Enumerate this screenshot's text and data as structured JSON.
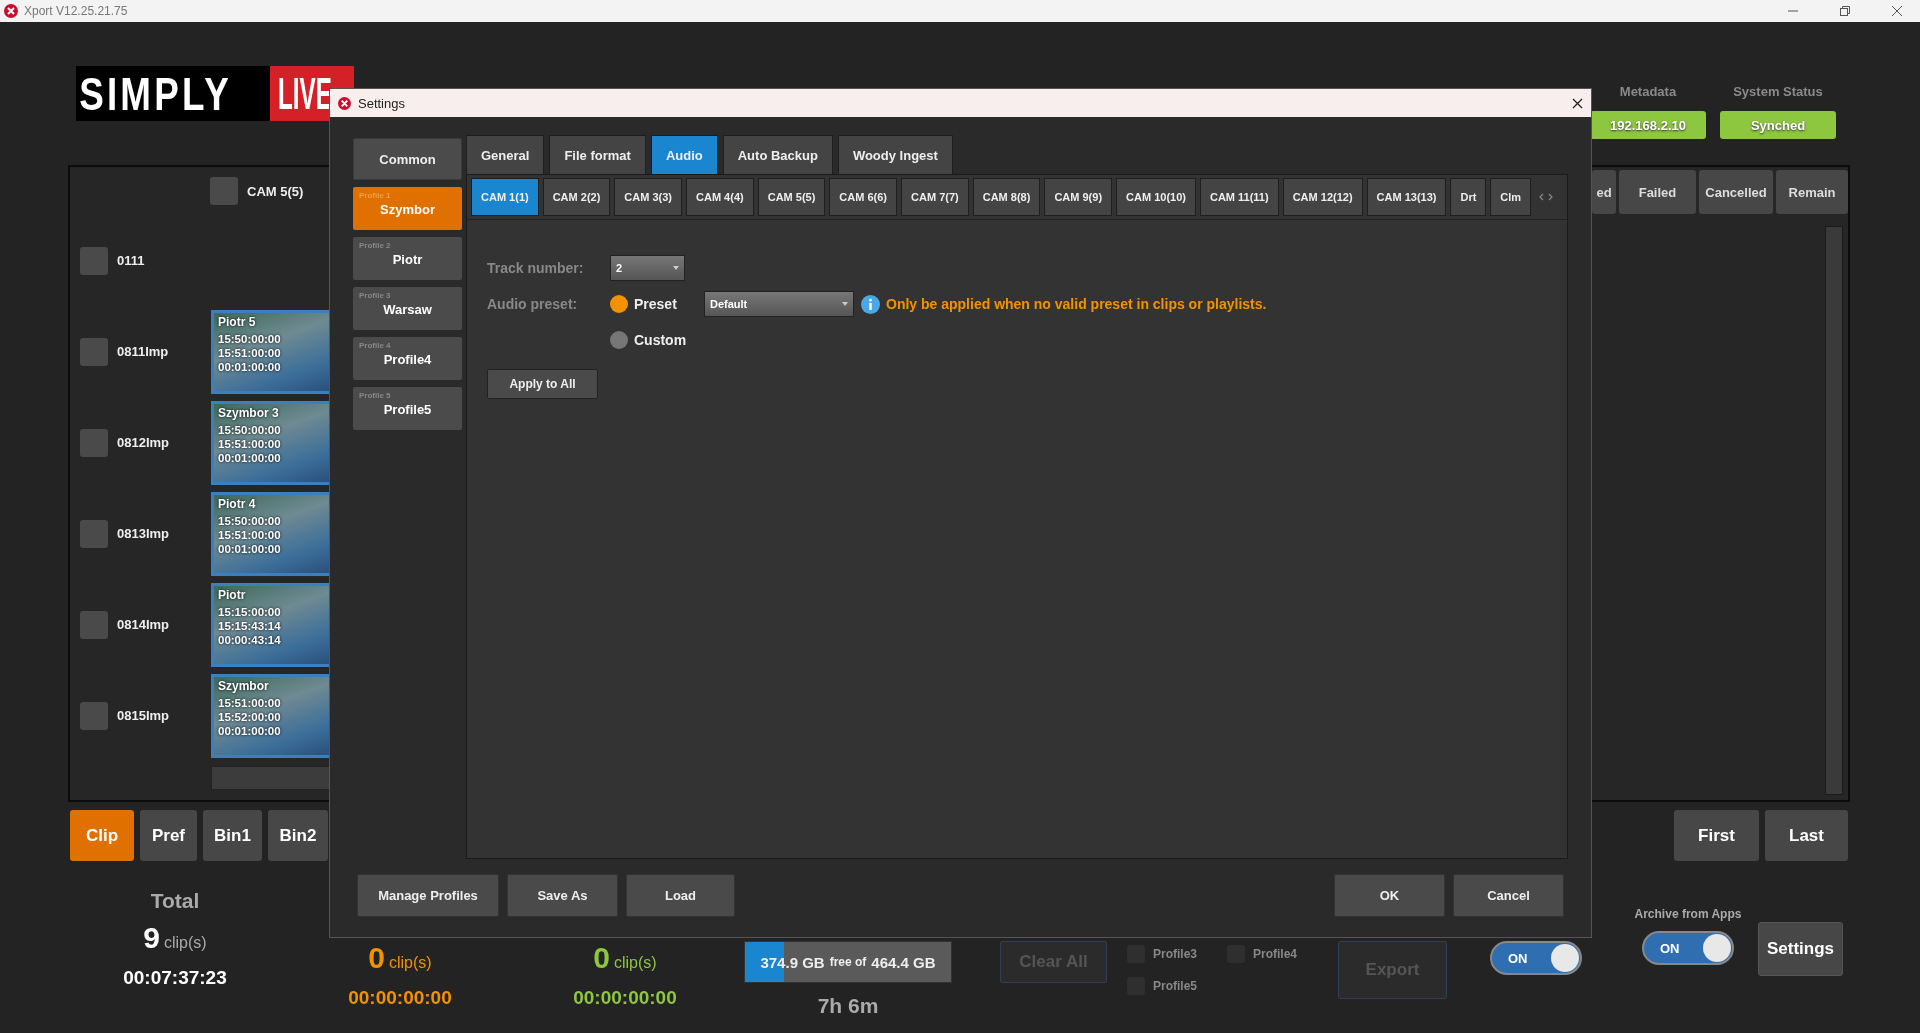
{
  "app": {
    "title": "Xport V12.25.21.75"
  },
  "logo": {
    "part_1": "SIMPLY",
    "part_2": "LIVE"
  },
  "header": {
    "metadata": {
      "label": "Metadata",
      "value": "192.168.2.10"
    },
    "system_status": {
      "label": "System Status",
      "value": "Synched"
    }
  },
  "clip_list": {
    "header": {
      "label": "CAM 5(5)",
      "checked": false
    },
    "rows": [
      {
        "label": "0111",
        "checked": false
      },
      {
        "label": "0811Imp",
        "checked": false,
        "thumbnail": {
          "title": "Piotr 5",
          "lines": [
            "15:50:00:00",
            "15:51:00:00",
            "00:01:00:00"
          ]
        }
      },
      {
        "label": "0812Imp",
        "checked": false,
        "thumbnail": {
          "title": "Szymbor 3",
          "lines": [
            "15:50:00:00",
            "15:51:00:00",
            "00:01:00:00"
          ]
        }
      },
      {
        "label": "0813Imp",
        "checked": false,
        "thumbnail": {
          "title": "Piotr 4",
          "lines": [
            "15:50:00:00",
            "15:51:00:00",
            "00:01:00:00"
          ]
        }
      },
      {
        "label": "0814Imp",
        "checked": false,
        "thumbnail": {
          "title": "Piotr",
          "lines": [
            "15:15:00:00",
            "15:15:43:14",
            "00:00:43:14"
          ]
        }
      },
      {
        "label": "0815Imp",
        "checked": false,
        "thumbnail": {
          "title": "Szymbor",
          "lines": [
            "15:51:00:00",
            "15:52:00:00",
            "00:01:00:00"
          ]
        }
      }
    ]
  },
  "status_columns": [
    "ed",
    "Failed",
    "Cancelled",
    "Remain"
  ],
  "bottom_tabs": [
    {
      "label": "Clip",
      "selected": true
    },
    {
      "label": "Pref",
      "selected": false
    },
    {
      "label": "Bin1",
      "selected": false
    },
    {
      "label": "Bin2",
      "selected": false
    }
  ],
  "nav_buttons": [
    "First",
    "Last"
  ],
  "stats": [
    {
      "label": "Total",
      "count": "9",
      "unit": "clip(s)",
      "duration": "00:07:37:23",
      "color": "#ffffff"
    },
    {
      "count": "0",
      "unit": "clip(s)",
      "duration": "00:00:00:00",
      "color": "#f39200"
    },
    {
      "count": "0",
      "unit": "clip(s)",
      "duration": "00:00:00:00",
      "color": "#8dc63f"
    }
  ],
  "storage": {
    "free": "374.9 GB",
    "free_of": "free of",
    "total": "464.4 GB",
    "level": 0.19,
    "remaining": "7h 6m"
  },
  "clear_all": {
    "label": "Clear All",
    "disabled": true
  },
  "profile_checks": [
    {
      "label": "Profile3",
      "checked": false
    },
    {
      "label": "Profile4",
      "checked": false
    },
    {
      "label": "Profile5",
      "checked": false
    }
  ],
  "export": {
    "label": "Export",
    "disabled": true
  },
  "toggle": {
    "label": "ON",
    "on": true
  },
  "archive": {
    "label": "Archive from Apps",
    "toggle": {
      "label": "ON",
      "on": true
    }
  },
  "settings_button": "Settings",
  "dialog": {
    "title": "Settings",
    "common": "Common",
    "profiles": [
      {
        "caption": "Profile 1",
        "name": "Szymbor",
        "selected": true
      },
      {
        "caption": "Profile 2",
        "name": "Piotr",
        "selected": false
      },
      {
        "caption": "Profile 3",
        "name": "Warsaw",
        "selected": false
      },
      {
        "caption": "Profile 4",
        "name": "Profile4",
        "selected": false
      },
      {
        "caption": "Profile 5",
        "name": "Profile5",
        "selected": false
      }
    ],
    "tabs": [
      {
        "label": "General",
        "selected": false
      },
      {
        "label": "File format",
        "selected": false
      },
      {
        "label": "Audio",
        "selected": true
      },
      {
        "label": "Auto Backup",
        "selected": false
      },
      {
        "label": "Woody Ingest",
        "selected": false
      }
    ],
    "cam_tabs": [
      {
        "label": "CAM 1(1)",
        "selected": true
      },
      {
        "label": "CAM 2(2)",
        "selected": false
      },
      {
        "label": "CAM 3(3)",
        "selected": false
      },
      {
        "label": "CAM 4(4)",
        "selected": false
      },
      {
        "label": "CAM 5(5)",
        "selected": false
      },
      {
        "label": "CAM 6(6)",
        "selected": false
      },
      {
        "label": "CAM 7(7)",
        "selected": false
      },
      {
        "label": "CAM 8(8)",
        "selected": false
      },
      {
        "label": "CAM 9(9)",
        "selected": false
      },
      {
        "label": "CAM 10(10)",
        "selected": false
      },
      {
        "label": "CAM 11(11)",
        "selected": false
      },
      {
        "label": "CAM 12(12)",
        "selected": false
      },
      {
        "label": "CAM 13(13)",
        "selected": false
      },
      {
        "label": "Drt",
        "selected": false
      },
      {
        "label": "Clm",
        "selected": false
      }
    ],
    "track_number": {
      "label": "Track number:",
      "value": "2"
    },
    "audio_preset": {
      "label": "Audio preset:",
      "options": [
        {
          "label": "Preset",
          "selected": true
        },
        {
          "label": "Custom",
          "selected": false
        }
      ],
      "preset_value": "Default",
      "note": "Only be applied when no valid preset in clips or playlists."
    },
    "apply_all": "Apply to All",
    "left_buttons": [
      "Manage Profiles",
      "Save As",
      "Load"
    ],
    "right_buttons": [
      "OK",
      "Cancel"
    ]
  }
}
